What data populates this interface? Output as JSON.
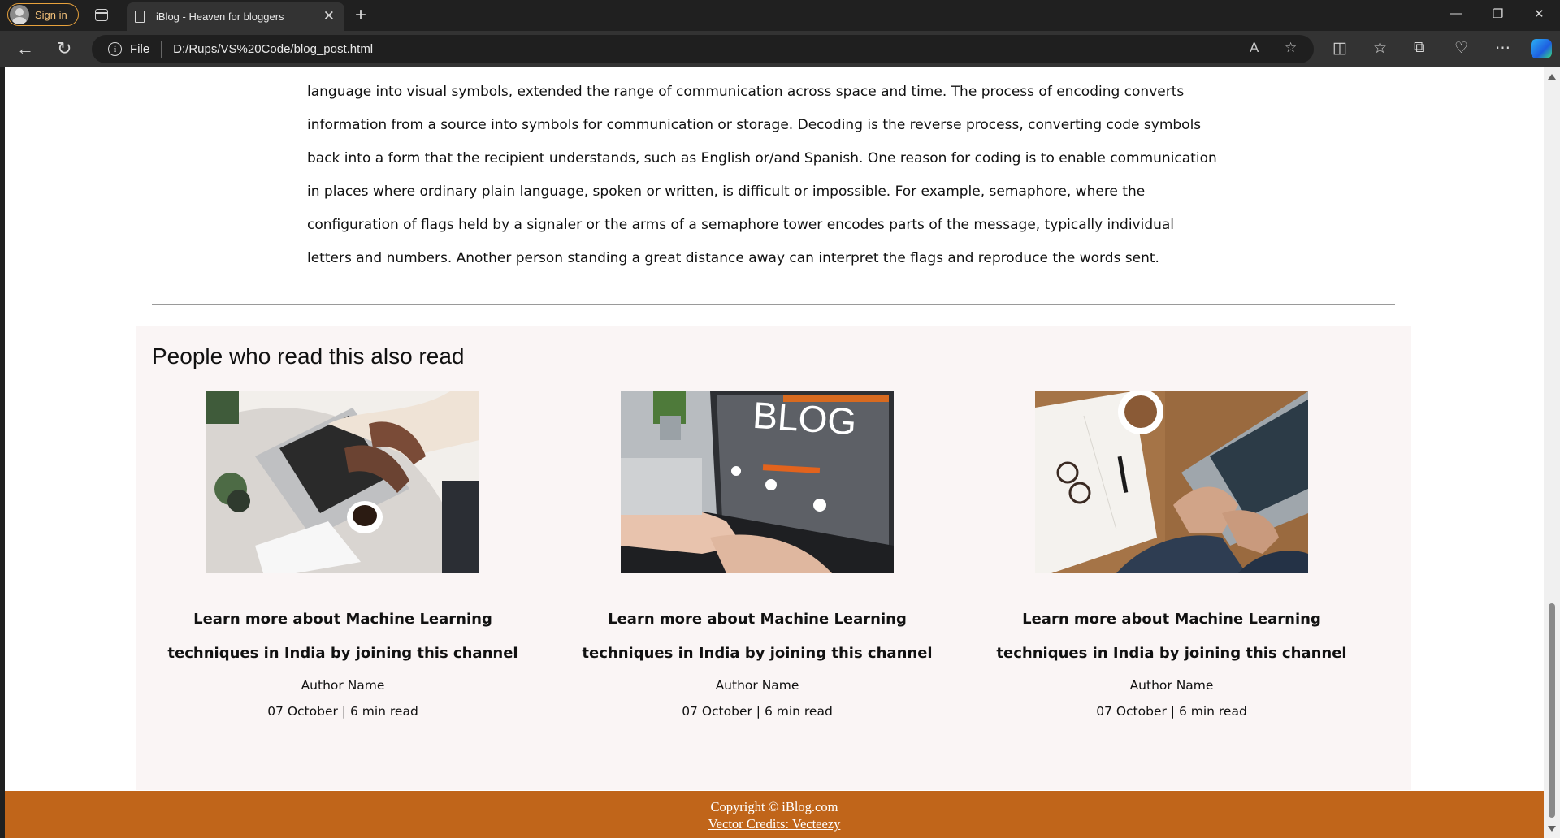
{
  "browser": {
    "signin_label": "Sign in",
    "tab_title": "iBlog - Heaven for bloggers",
    "address_scheme": "File",
    "address_url": "D:/Rups/VS%20Code/blog_post.html"
  },
  "article": {
    "lines": [
      "language into visual symbols, extended the range of communication across space and time. The process of encoding converts",
      "information from a source into symbols for communication or storage. Decoding is the reverse process, converting code symbols",
      "back into a form that the recipient understands, such as English or/and Spanish. One reason for coding is to enable communication",
      "in places where ordinary plain language, spoken or written, is difficult or impossible. For example, semaphore, where the",
      "configuration of flags held by a signaler or the arms of a semaphore tower encodes parts of the message, typically individual",
      "letters and numbers. Another person standing a great distance away can interpret the flags and reproduce the words sent."
    ]
  },
  "related": {
    "heading": "People who read this also read",
    "cards": [
      {
        "title_line1": "Learn more about Machine Learning",
        "title_line2": "techniques in India by joining this channel",
        "author": "Author Name",
        "meta": "07 October | 6 min read"
      },
      {
        "title_line1": "Learn more about Machine Learning",
        "title_line2": "techniques in India by joining this channel",
        "author": "Author Name",
        "meta": "07 October | 6 min read",
        "image_text": "BLOG"
      },
      {
        "title_line1": "Learn more about Machine Learning",
        "title_line2": "techniques in India by joining this channel",
        "author": "Author Name",
        "meta": "07 October | 6 min read"
      }
    ]
  },
  "footer": {
    "copyright": "Copyright © iBlog.com",
    "credits": "Vector Credits: Vecteezy"
  },
  "colors": {
    "footer_bg": "#c0651a",
    "related_bg": "#faf5f5",
    "signin_accent": "#e8a23c"
  },
  "icons": [
    "user-avatar-icon",
    "tab-actions-icon",
    "page-icon",
    "close-icon",
    "new-tab-icon",
    "minimize-icon",
    "restore-icon",
    "window-close-icon",
    "back-icon",
    "refresh-icon",
    "info-icon",
    "read-aloud-icon",
    "favorite-star-icon",
    "split-screen-icon",
    "favorites-icon",
    "collections-icon",
    "browser-essentials-icon",
    "more-icon",
    "copilot-icon"
  ]
}
